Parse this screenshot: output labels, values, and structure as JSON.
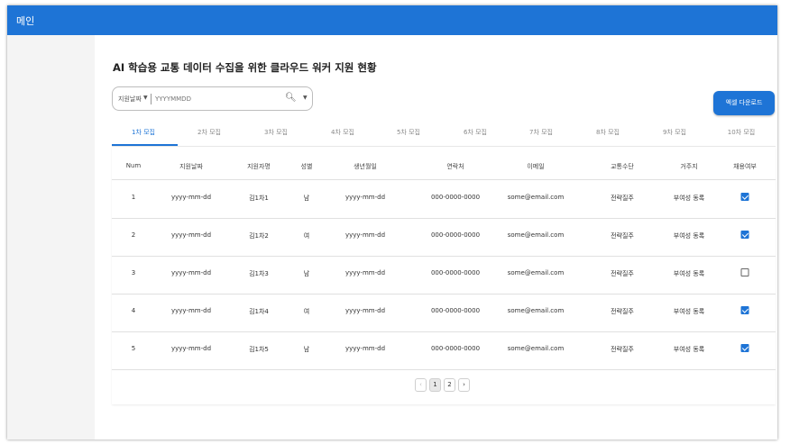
{
  "app": {
    "title": "메인"
  },
  "page": {
    "heading": "AI 학습용 교통 데이터 수집을 위한 클라우드 워커 지원 현황"
  },
  "search": {
    "filter_label": "지원날짜",
    "date_placeholder": "YYYYMMDD"
  },
  "excel_button": {
    "label": "엑셀 다운로드"
  },
  "tabs": [
    {
      "label": "1차 모집",
      "active": true
    },
    {
      "label": "2차 모집"
    },
    {
      "label": "3차 모집"
    },
    {
      "label": "4차 모집"
    },
    {
      "label": "5차 모집"
    },
    {
      "label": "6차 모집"
    },
    {
      "label": "7차 모집"
    },
    {
      "label": "8차 모집"
    },
    {
      "label": "9차 모집"
    },
    {
      "label": "10차 모집"
    }
  ],
  "table": {
    "columns": [
      "Num",
      "지원날짜",
      "지원자명",
      "성별",
      "생년월일",
      "연락처",
      "이메일",
      "교통수단",
      "거주지",
      "채용여부"
    ],
    "rows": [
      {
        "num": "1",
        "date": "yyyy-mm-dd",
        "name": "김1차1",
        "gender": "남",
        "birth": "yyyy-mm-dd",
        "phone": "000-0000-0000",
        "email": "some@email.com",
        "transport": "전략질주",
        "residence": "부여성 동록",
        "hired": true
      },
      {
        "num": "2",
        "date": "yyyy-mm-dd",
        "name": "김1차2",
        "gender": "여",
        "birth": "yyyy-mm-dd",
        "phone": "000-0000-0000",
        "email": "some@email.com",
        "transport": "전략질주",
        "residence": "부여성 동록",
        "hired": true
      },
      {
        "num": "3",
        "date": "yyyy-mm-dd",
        "name": "김1차3",
        "gender": "남",
        "birth": "yyyy-mm-dd",
        "phone": "000-0000-0000",
        "email": "some@email.com",
        "transport": "전략질주",
        "residence": "부여성 동록",
        "hired": false
      },
      {
        "num": "4",
        "date": "yyyy-mm-dd",
        "name": "김1차4",
        "gender": "여",
        "birth": "yyyy-mm-dd",
        "phone": "000-0000-0000",
        "email": "some@email.com",
        "transport": "전략질주",
        "residence": "부여성 동록",
        "hired": true
      },
      {
        "num": "5",
        "date": "yyyy-mm-dd",
        "name": "김1차5",
        "gender": "남",
        "birth": "yyyy-mm-dd",
        "phone": "000-0000-0000",
        "email": "some@email.com",
        "transport": "전략질주",
        "residence": "부여성 동록",
        "hired": true
      }
    ]
  },
  "pagination": {
    "prev": "‹",
    "pages": [
      "1",
      "2"
    ],
    "current": "1",
    "next": "›"
  },
  "icons": {
    "search": "search-icon",
    "dropdown": "chevron-down-icon",
    "checkbox": "checkbox-icon"
  },
  "colors": {
    "accent": "#1e74d6"
  }
}
